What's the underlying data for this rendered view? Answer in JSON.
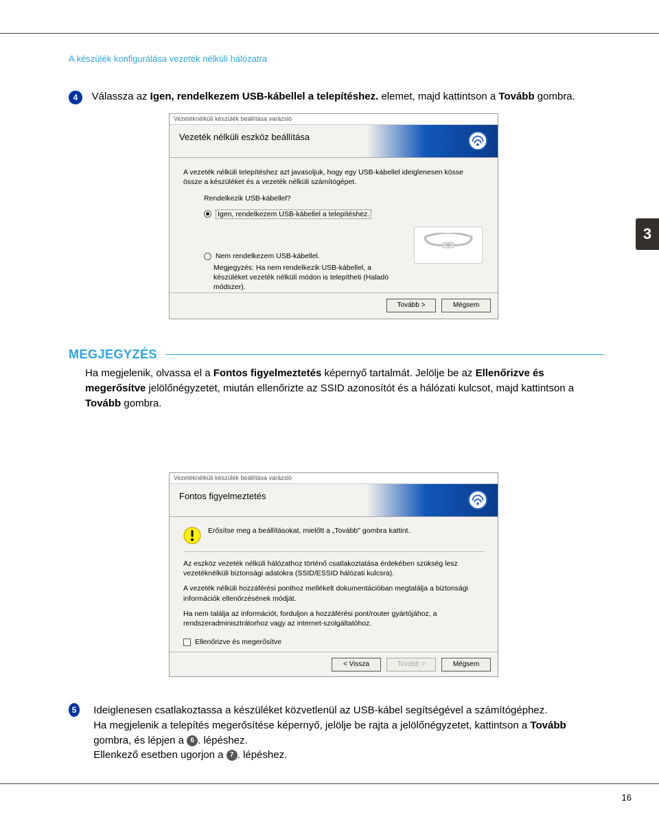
{
  "header": {
    "section_title": "A készülék konfigurálása vezeték nélküli hálózatra"
  },
  "side_tab": {
    "number": "3"
  },
  "step4": {
    "badge": "4",
    "prefix": "Válassza az ",
    "bold1": "Igen, rendelkezem USB-kábellel a telepítéshez.",
    "mid": " elemet, majd kattintson a ",
    "bold2": "Tovább",
    "suffix": " gombra."
  },
  "wizard1": {
    "titlebar": "Vezetéknélküli készülék beállítása varázsló",
    "header_title": "Vezeték nélküli eszköz beállítása",
    "intro": "A vezeték nélküli telepítéshez azt javasoljuk, hogy egy USB-kábellel ideiglenesen kösse össze a készüléket és a vezeték nélküli számítógépet.",
    "q": "Rendelkezik USB-kábellel?",
    "opt1": "Igen, rendelkezem USB-kábellel a telepítéshez.",
    "opt2": "Nem rendelkezem USB-kábellel.",
    "note": "Megjegyzés: Ha nem rendelkezik USB-kábellel, a készüléket vezeték nélküli módon is telepítheti (Haladó módszer).",
    "btn_next": "Tovább >",
    "btn_cancel": "Mégsem"
  },
  "note_block": {
    "heading": "MEGJEGYZÉS",
    "line1_a": "Ha megjelenik, olvassa el a ",
    "line1_b": "Fontos figyelmeztetés",
    "line1_c": " képernyő tartalmát. Jelölje be az ",
    "line1_d": "Ellenőrizve és megerősítve",
    "line1_e": " jelölőnégyzetet, miután ellenőrizte az SSID azonosítót és a hálózati kulcsot, majd kattintson a ",
    "line1_f": "Tovább",
    "line1_g": " gombra."
  },
  "wizard2": {
    "titlebar": "Vezetéknélküli készülék beállítása varázsló",
    "header_title": "Fontos figyelmeztetés",
    "warn_line": "Erősítse meg a beállításokat, mielőtt a „Tovább\" gombra kattint.",
    "p1": "Az eszköz vezeték nélküli hálózathoz történő csatlakoztatása érdekében szükség lesz vezetéknélküli biztonsági adatokra (SSID/ESSID hálózati kulcsra).",
    "p2": "A vezeték nélküli hozzáférési ponthoz mellékelt dokumentációban megtalálja a biztonsági információk ellenőrzésének módját.",
    "p3": "Ha nem találja az információt, forduljon a hozzáférési pont/router gyártójához, a rendszeradminisztrátorhoz vagy az internet-szolgáltatóhoz.",
    "check_label": "Ellenőrizve és megerősítve",
    "btn_back": "< Vissza",
    "btn_next": "Tovább >",
    "btn_cancel": "Mégsem"
  },
  "step5": {
    "badge": "5",
    "l1": "Ideiglenesen csatlakoztassa a készüléket közvetlenül az USB-kábel segítségével a számítógéphez.",
    "l2_a": "Ha megjelenik a telepítés megerősítése képernyő, jelölje be rajta a jelölőnégyzetet, kattintson a ",
    "l2_b": "Tovább",
    "l2_c": " gombra, és lépjen a ",
    "ref1": "6",
    "l2_d": ". lépéshez.",
    "l3_a": "Ellenkező esetben ugorjon a ",
    "ref2": "7",
    "l3_b": ". lépéshez."
  },
  "page_number": "16"
}
